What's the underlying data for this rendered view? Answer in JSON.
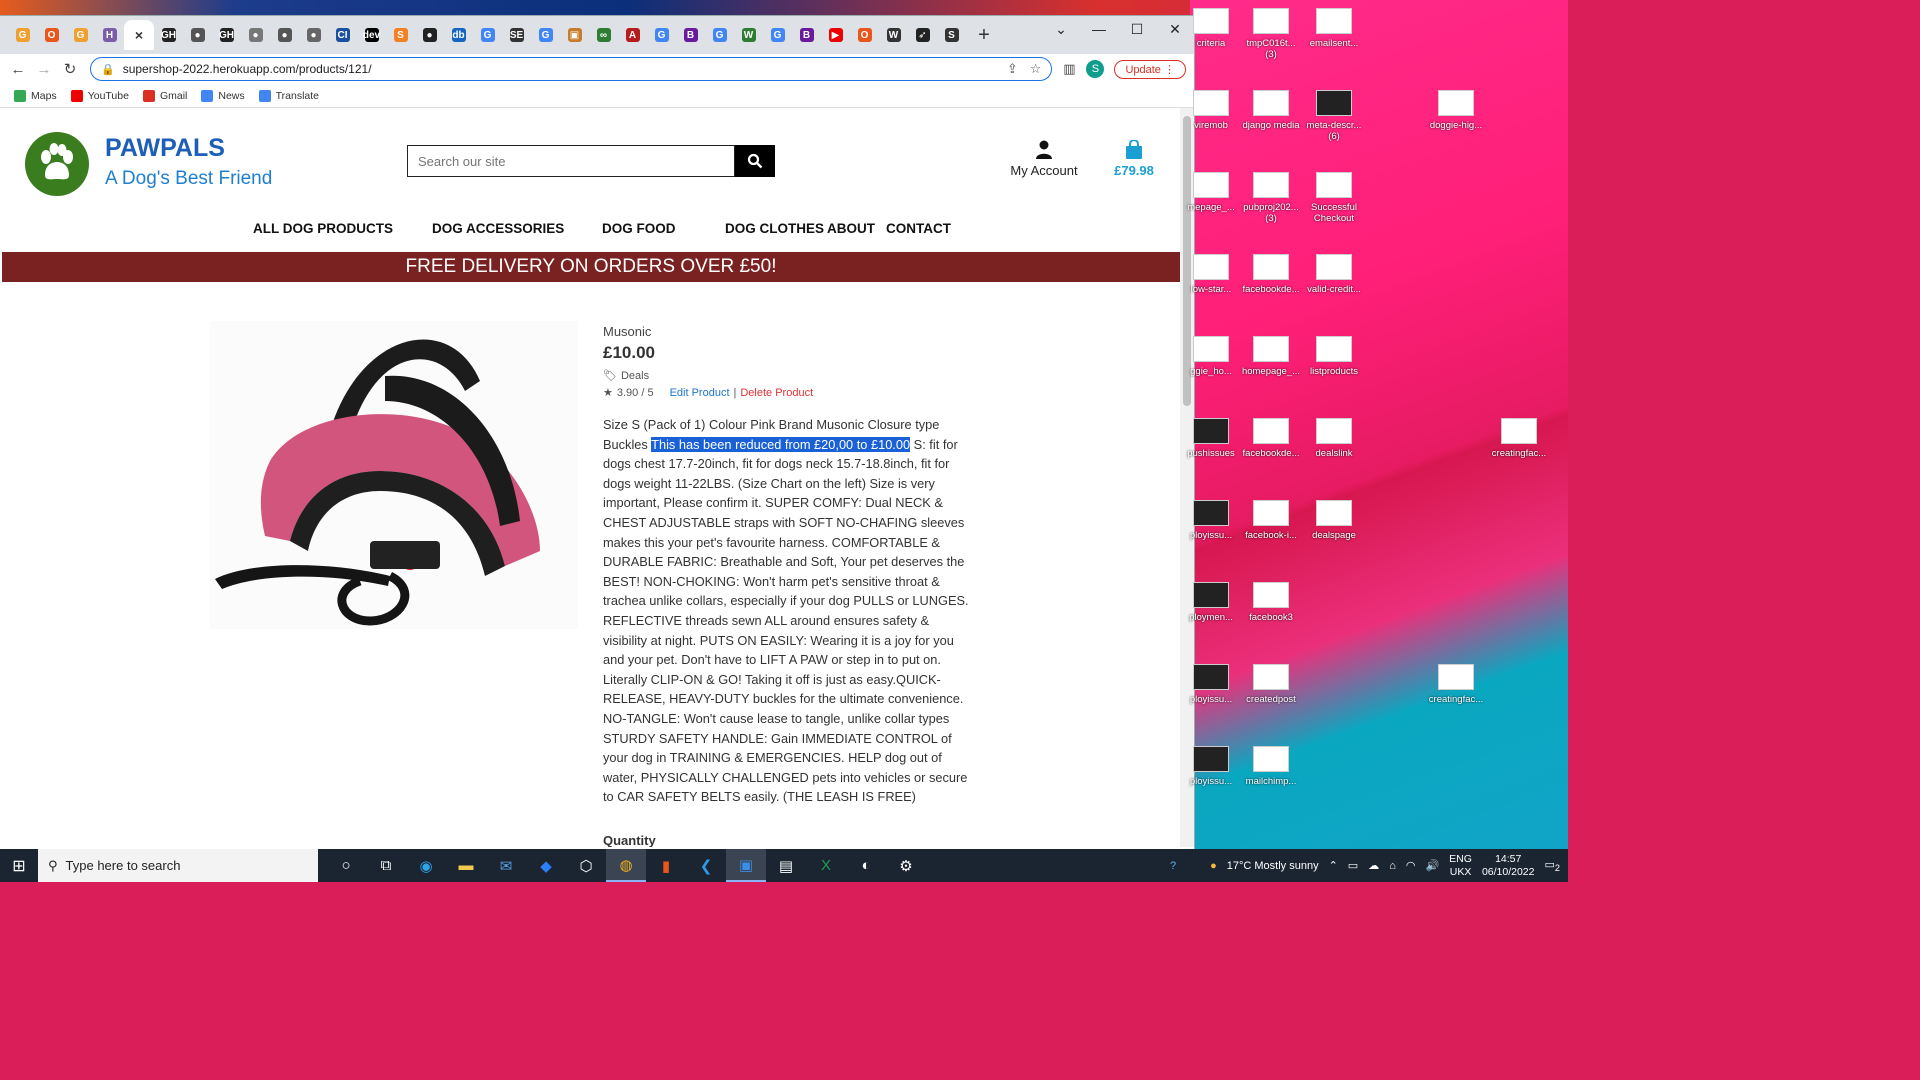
{
  "browser": {
    "tabs": [
      {
        "icon": "G",
        "color": "#f0a030"
      },
      {
        "icon": "O",
        "color": "#e8561c"
      },
      {
        "icon": "G",
        "color": "#f0a030"
      },
      {
        "icon": "H",
        "color": "#7b5ea7"
      },
      {
        "icon": "GH",
        "color": "#222"
      },
      {
        "icon": "●",
        "color": "#555"
      },
      {
        "icon": "GH",
        "color": "#222"
      },
      {
        "icon": "●",
        "color": "#777"
      },
      {
        "icon": "●",
        "color": "#555"
      },
      {
        "icon": "●",
        "color": "#666"
      },
      {
        "icon": "CI",
        "color": "#1b4fa0"
      },
      {
        "icon": "dev",
        "color": "#000"
      },
      {
        "icon": "S",
        "color": "#f48024"
      },
      {
        "icon": "●",
        "color": "#222"
      },
      {
        "icon": "db",
        "color": "#1565c0"
      },
      {
        "icon": "G",
        "color": "#4285f4"
      },
      {
        "icon": "SE",
        "color": "#333"
      },
      {
        "icon": "G",
        "color": "#4285f4"
      },
      {
        "icon": "▣",
        "color": "#c87b2a"
      },
      {
        "icon": "∞",
        "color": "#2e7d32"
      },
      {
        "icon": "A",
        "color": "#b71c1c"
      },
      {
        "icon": "G",
        "color": "#4285f4"
      },
      {
        "icon": "B",
        "color": "#6a1b9a"
      },
      {
        "icon": "G",
        "color": "#4285f4"
      },
      {
        "icon": "W",
        "color": "#2e7d32"
      },
      {
        "icon": "G",
        "color": "#4285f4"
      },
      {
        "icon": "B",
        "color": "#6a1b9a"
      },
      {
        "icon": "▶",
        "color": "#e00"
      },
      {
        "icon": "O",
        "color": "#e8561c"
      },
      {
        "icon": "W",
        "color": "#333"
      },
      {
        "icon": "➶",
        "color": "#222"
      },
      {
        "icon": "S",
        "color": "#333"
      }
    ],
    "active_tab_close": "×",
    "new_tab": "+",
    "url": "supershop-2022.herokuapp.com/products/121/",
    "profile_initial": "S",
    "update_label": "Update",
    "bookmarks": [
      {
        "label": "Maps",
        "color": "#34a853"
      },
      {
        "label": "YouTube",
        "color": "#e00"
      },
      {
        "label": "Gmail",
        "color": "#d93025"
      },
      {
        "label": "News",
        "color": "#4285f4"
      },
      {
        "label": "Translate",
        "color": "#4285f4"
      }
    ]
  },
  "site": {
    "brand": "PAWPALS",
    "tagline": "A Dog's Best Friend",
    "search_placeholder": "Search our site",
    "account_label": "My Account",
    "cart_total": "£79.98",
    "nav": [
      "ALL DOG PRODUCTS",
      "DOG ACCESSORIES",
      "DOG FOOD",
      "DOG CLOTHES",
      "ABOUT",
      "CONTACT"
    ],
    "banner": "FREE DELIVERY ON ORDERS OVER £50!"
  },
  "product": {
    "brand": "Musonic",
    "price": "£10.00",
    "category": "Deals",
    "rating": "3.90 / 5",
    "edit_label": "Edit Product",
    "separator": "|",
    "delete_label": "Delete Product",
    "desc_before": "Size S (Pack of 1) Colour Pink Brand Musonic Closure type Buckles ",
    "desc_highlight": "This has been reduced from £20,00 to £10.00",
    "desc_after": " S: fit for dogs chest 17.7-20inch, fit for dogs neck 15.7-18.8inch, fit for dogs weight 11-22LBS. (Size Chart on the left) Size is very important, Please confirm it. SUPER COMFY: Dual NECK & CHEST ADJUSTABLE straps with SOFT NO-CHAFING sleeves makes this your pet's favourite harness. COMFORTABLE & DURABLE FABRIC: Breathable and Soft, Your pet deserves the BEST! NON-CHOKING: Won't harm pet's sensitive throat & trachea unlike collars, especially if your dog PULLS or LUNGES. REFLECTIVE threads sewn ALL around ensures safety & visibility at night. PUTS ON EASILY: Wearing it is a joy for you and your pet. Don't have to LIFT A PAW or step in to put on. Literally CLIP-ON & GO! Taking it off is just as easy.QUICK-RELEASE, HEAVY-DUTY buckles for the ultimate convenience. NO-TANGLE: Won't cause lease to tangle, unlike collar types STURDY SAFETY HANDLE: Gain IMMEDIATE CONTROL of your dog in TRAINING & EMERGENCIES. HELP dog out of water, PHYSICALLY CHALLENGED pets into vehicles or secure to CAR SAFETY BELTS easily.    (THE LEASH IS FREE)",
    "quantity_label": "Quantity"
  },
  "desktop_icons": [
    {
      "label": "criteria",
      "dark": false
    },
    {
      "label": "tmpC016t... (3)",
      "dark": false
    },
    {
      "label": "emailsent...",
      "dark": false
    },
    {
      "label": "viremob",
      "dark": false
    },
    {
      "label": "django media",
      "dark": false
    },
    {
      "label": "meta-descr... (6)",
      "dark": true
    },
    {
      "label": "doggie-hig...",
      "dark": false
    },
    {
      "label": "mepage_...",
      "dark": false
    },
    {
      "label": "pubproj202... (3)",
      "dark": false
    },
    {
      "label": "Successful Checkout",
      "dark": false
    },
    {
      "label": "low-star...",
      "dark": false
    },
    {
      "label": "facebookde...",
      "dark": false
    },
    {
      "label": "valid-credit...",
      "dark": false
    },
    {
      "label": "ggie_ho...",
      "dark": false
    },
    {
      "label": "homepage_...",
      "dark": false
    },
    {
      "label": "listproducts",
      "dark": false
    },
    {
      "label": "pushissues",
      "dark": true
    },
    {
      "label": "facebookde...",
      "dark": false
    },
    {
      "label": "dealslink",
      "dark": false
    },
    {
      "label": "creatingfac...",
      "dark": false
    },
    {
      "label": "ployissu...",
      "dark": true
    },
    {
      "label": "facebook-i...",
      "dark": false
    },
    {
      "label": "dealspage",
      "dark": false
    },
    {
      "label": "ploymen...",
      "dark": true
    },
    {
      "label": "facebook3",
      "dark": false
    },
    {
      "label": "ployissu...",
      "dark": true
    },
    {
      "label": "createdpost",
      "dark": false
    },
    {
      "label": "creatingfac...",
      "dark": false
    },
    {
      "label": "ployissu...",
      "dark": true
    },
    {
      "label": "mailchimp...",
      "dark": false
    }
  ],
  "taskbar": {
    "search_placeholder": "Type here to search",
    "weather": "17°C  Mostly sunny",
    "lang_top": "ENG",
    "lang_bottom": "UKX",
    "time": "14:57",
    "date": "06/10/2022",
    "notifications": "2"
  }
}
